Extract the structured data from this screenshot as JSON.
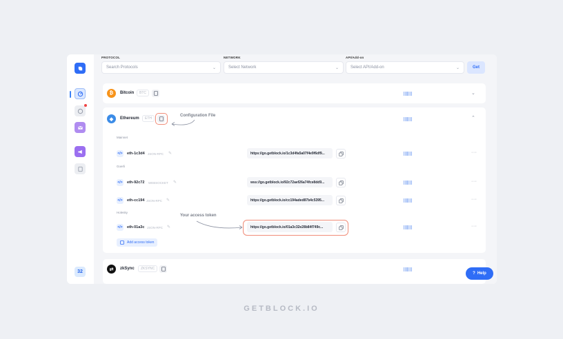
{
  "filters": {
    "protocol": {
      "label": "PROTOCOL",
      "placeholder": "Search Protocols"
    },
    "network": {
      "label": "NETWORK",
      "placeholder": "Select Network"
    },
    "api": {
      "label": "API/Add-on",
      "placeholder": "Select API/Add-on"
    },
    "get_label": "Get"
  },
  "sidebar": {
    "counter": "32"
  },
  "protocols": {
    "bitcoin": {
      "name": "Bitcoin",
      "ticker": "BTC"
    },
    "ethereum": {
      "name": "Ethereum",
      "ticker": "ETH"
    },
    "zksync": {
      "name": "zkSync",
      "ticker": "ZKSYNC"
    }
  },
  "sections": {
    "mainnet": "Mainnet",
    "goerli": "Goerli",
    "holesky": "Holesky"
  },
  "endpoints": [
    {
      "name": "eth-1c3d4",
      "type": "JSON-RPC",
      "url": "https://go.getblock.io/1c3d4fa5a07f4e9f6df9..."
    },
    {
      "name": "eth-92c72",
      "type": "WEBSOCKET",
      "url": "wss://go.getblock.io/92c72aef26a74fce8dd9..."
    },
    {
      "name": "eth-cc194",
      "type": "JSON-RPC",
      "url": "https://go.getblock.io/cc194aded87b4c5395..."
    },
    {
      "name": "eth-01a3c",
      "type": "JSON-RPC",
      "url": "https://go.getblock.io/01a3c32e28b84f749c..."
    }
  ],
  "add_token_label": "Add access token",
  "annotations": {
    "config_file": "Configuration File",
    "access_token": "Your access token"
  },
  "help_label": "Help",
  "brand": "GETBLOCK.IO",
  "colors": {
    "accent": "#2f6df6",
    "highlight": "#f08c78",
    "bitcoin": "#f7931a",
    "ethereum": "#3c8ce7"
  }
}
